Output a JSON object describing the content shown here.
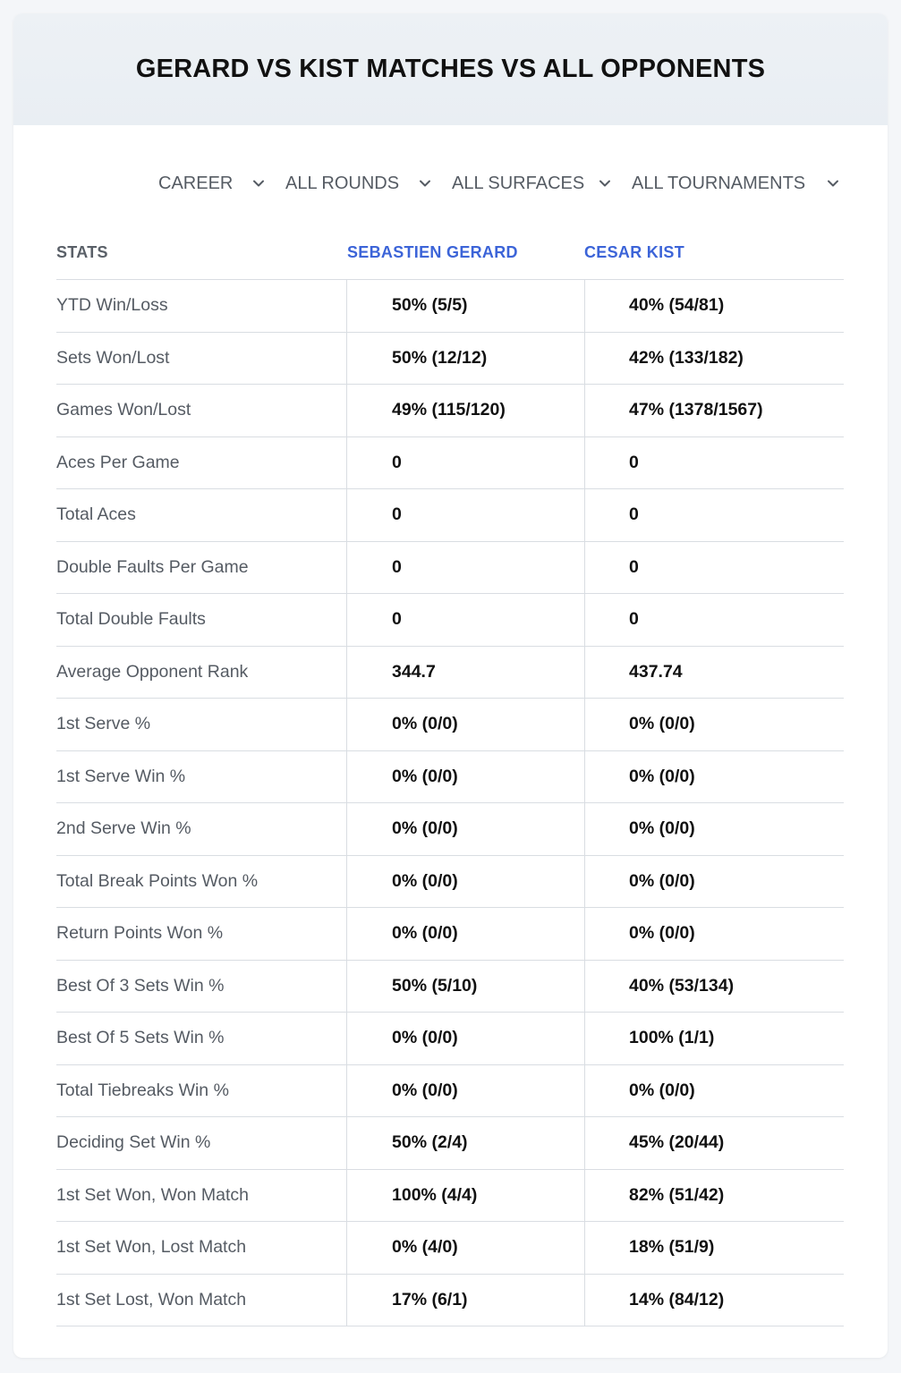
{
  "title": "GERARD VS KIST MATCHES VS ALL OPPONENTS",
  "filters": [
    {
      "label": "CAREER"
    },
    {
      "label": "ALL ROUNDS"
    },
    {
      "label": "ALL SURFACES"
    },
    {
      "label": "ALL TOURNAMENTS"
    }
  ],
  "headers": {
    "stats": "STATS",
    "player1": "SEBASTIEN GERARD",
    "player2": "CESAR KIST"
  },
  "colors": {
    "accent": "#3c64d8",
    "label": "#555b63",
    "divider": "#d9dde2",
    "header_bg": "#edf1f5"
  },
  "rows": [
    {
      "stat": "YTD Win/Loss",
      "p1": "50% (5/5)",
      "p2": "40% (54/81)"
    },
    {
      "stat": "Sets Won/Lost",
      "p1": "50% (12/12)",
      "p2": "42% (133/182)"
    },
    {
      "stat": "Games Won/Lost",
      "p1": "49% (115/120)",
      "p2": "47% (1378/1567)"
    },
    {
      "stat": "Aces Per Game",
      "p1": "0",
      "p2": "0"
    },
    {
      "stat": "Total Aces",
      "p1": "0",
      "p2": "0"
    },
    {
      "stat": "Double Faults Per Game",
      "p1": "0",
      "p2": "0"
    },
    {
      "stat": "Total Double Faults",
      "p1": "0",
      "p2": "0"
    },
    {
      "stat": "Average Opponent Rank",
      "p1": "344.7",
      "p2": "437.74"
    },
    {
      "stat": "1st Serve %",
      "p1": "0% (0/0)",
      "p2": "0% (0/0)"
    },
    {
      "stat": "1st Serve Win %",
      "p1": "0% (0/0)",
      "p2": "0% (0/0)"
    },
    {
      "stat": "2nd Serve Win %",
      "p1": "0% (0/0)",
      "p2": "0% (0/0)"
    },
    {
      "stat": "Total Break Points Won %",
      "p1": "0% (0/0)",
      "p2": "0% (0/0)"
    },
    {
      "stat": "Return Points Won %",
      "p1": "0% (0/0)",
      "p2": "0% (0/0)"
    },
    {
      "stat": "Best Of 3 Sets Win %",
      "p1": "50% (5/10)",
      "p2": "40% (53/134)"
    },
    {
      "stat": "Best Of 5 Sets Win %",
      "p1": "0% (0/0)",
      "p2": "100% (1/1)"
    },
    {
      "stat": "Total Tiebreaks Win %",
      "p1": "0% (0/0)",
      "p2": "0% (0/0)"
    },
    {
      "stat": "Deciding Set Win %",
      "p1": "50% (2/4)",
      "p2": "45% (20/44)"
    },
    {
      "stat": "1st Set Won, Won Match",
      "p1": "100% (4/4)",
      "p2": "82% (51/42)"
    },
    {
      "stat": "1st Set Won, Lost Match",
      "p1": "0% (4/0)",
      "p2": "18% (51/9)"
    },
    {
      "stat": "1st Set Lost, Won Match",
      "p1": "17% (6/1)",
      "p2": "14% (84/12)"
    }
  ]
}
